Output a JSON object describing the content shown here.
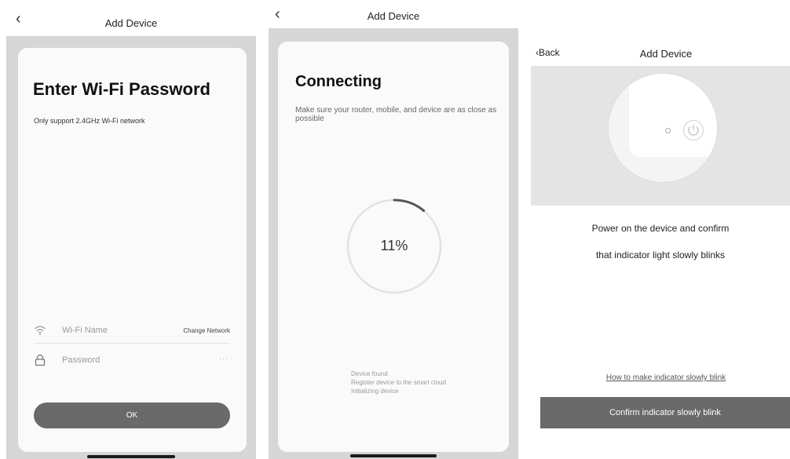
{
  "screens": [
    {
      "nav_title": "Add Device",
      "heading": "Enter Wi-Fi Password",
      "subtitle": "Only support 2.4GHz Wi-Fi network",
      "wifi_name_placeholder": "Wi-Fi Name",
      "change_network": "Change Network",
      "password_placeholder": "Password",
      "password_dots": "···",
      "ok_label": "OK"
    },
    {
      "nav_title": "Add Device",
      "heading": "Connecting",
      "subtitle": "Make sure your router, mobile, and device are as close as possible",
      "progress": 0.11,
      "progress_text": "11%",
      "steps": [
        "Device found",
        "Register device to the smart cloud",
        "Initializing device"
      ]
    },
    {
      "back_label": "Back",
      "nav_title": "Add Device",
      "message_line1": "Power on the device and confirm",
      "message_line2": "that indicator light slowly blinks",
      "help_link": "How to make indicator slowly blink",
      "confirm_label": "Confirm indicator slowly blink"
    }
  ],
  "icons": {
    "back": "chevron-left-icon",
    "wifi": "wifi-icon",
    "password": "lock-icon",
    "power": "power-icon"
  },
  "colors": {
    "button_gray": "#6a6a6a",
    "page_gray": "#d6d6d6",
    "ring_track": "#e2e2e2",
    "ring_progress": "#555555"
  }
}
